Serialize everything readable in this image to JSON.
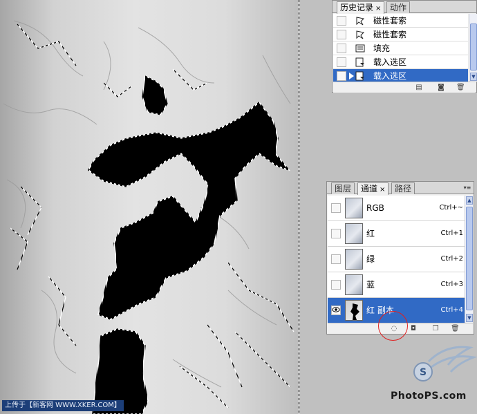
{
  "canvas": {
    "watermark": "上传于【新客网 WWW.XKER.COM】"
  },
  "history": {
    "tabs": [
      {
        "label": "历史记录",
        "active": true
      },
      {
        "label": "动作",
        "active": false
      }
    ],
    "close_glyph": "×",
    "items": [
      {
        "label": "磁性套索",
        "icon": "lasso-icon",
        "selected": false
      },
      {
        "label": "磁性套索",
        "icon": "lasso-icon",
        "selected": false
      },
      {
        "label": "填充",
        "icon": "fill-icon",
        "selected": false
      },
      {
        "label": "载入选区",
        "icon": "load-selection-icon",
        "selected": false
      },
      {
        "label": "载入选区",
        "icon": "load-selection-icon",
        "selected": true
      }
    ],
    "footer_icons": [
      "new-document-icon",
      "camera-icon",
      "trash-icon"
    ]
  },
  "channels": {
    "tabs": [
      {
        "label": "图层",
        "active": false
      },
      {
        "label": "通道",
        "active": true
      },
      {
        "label": "路径",
        "active": false
      }
    ],
    "close_glyph": "×",
    "rows": [
      {
        "label": "RGB",
        "shortcut": "Ctrl+~",
        "visible": false,
        "selected": false
      },
      {
        "label": "红",
        "shortcut": "Ctrl+1",
        "visible": false,
        "selected": false
      },
      {
        "label": "绿",
        "shortcut": "Ctrl+2",
        "visible": false,
        "selected": false
      },
      {
        "label": "蓝",
        "shortcut": "Ctrl+3",
        "visible": false,
        "selected": false
      },
      {
        "label": "红 副本",
        "shortcut": "Ctrl+4",
        "visible": true,
        "selected": true
      }
    ],
    "footer_icons": [
      "load-channel-as-selection-icon",
      "save-selection-as-channel-icon",
      "new-channel-icon",
      "trash-icon"
    ]
  },
  "logo": {
    "text": "PhotoPS.com"
  },
  "colors": {
    "selection": "#316ac5",
    "panel_bg": "#f0f0f0",
    "annotation_circle": "#e02020"
  }
}
